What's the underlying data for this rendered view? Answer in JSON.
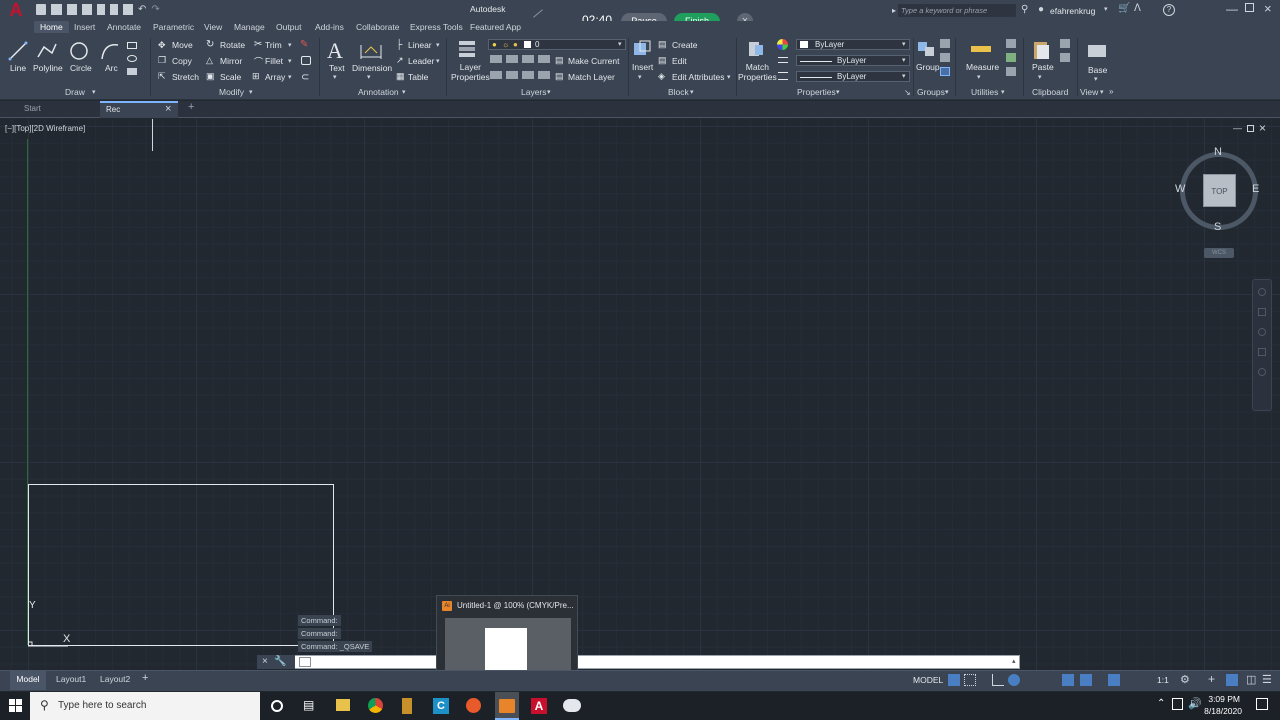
{
  "app": {
    "title": "Autodesk",
    "timer": "02:40",
    "pause_label": "Pause",
    "finish_label": "Finish",
    "search_placeholder": "Type a keyword or phrase",
    "user": "efahrenkrug"
  },
  "ribbon_tabs": [
    "Home",
    "Insert",
    "Annotate",
    "Parametric",
    "View",
    "Manage",
    "Output",
    "Add-ins",
    "Collaborate",
    "Express Tools",
    "Featured App"
  ],
  "draw": {
    "line": "Line",
    "polyline": "Polyline",
    "circle": "Circle",
    "arc": "Arc",
    "panel": "Draw"
  },
  "modify": {
    "move": "Move",
    "rotate": "Rotate",
    "trim": "Trim",
    "copy": "Copy",
    "mirror": "Mirror",
    "fillet": "Fillet",
    "stretch": "Stretch",
    "scale": "Scale",
    "array": "Array",
    "panel": "Modify"
  },
  "annotation": {
    "text": "Text",
    "dimension": "Dimension",
    "linear": "Linear",
    "leader": "Leader",
    "table": "Table",
    "panel": "Annotation"
  },
  "layers": {
    "layer_properties": "Layer\nProperties",
    "current_layer": "0",
    "make_current": "Make Current",
    "match_layer": "Match Layer",
    "panel": "Layers"
  },
  "block": {
    "insert": "Insert",
    "create": "Create",
    "edit": "Edit",
    "edit_attributes": "Edit Attributes",
    "panel": "Block"
  },
  "properties": {
    "match": "Match\nProperties",
    "color": "ByLayer",
    "linetype": "ByLayer",
    "lineweight": "ByLayer",
    "panel": "Properties"
  },
  "groups": {
    "group": "Group",
    "panel": "Groups"
  },
  "utilities": {
    "measure": "Measure",
    "panel": "Utilities"
  },
  "clipboard": {
    "paste": "Paste",
    "panel": "Clipboard"
  },
  "view": {
    "base": "Base",
    "panel": "View"
  },
  "doc_tabs": {
    "start": "Start",
    "rec": "Rec"
  },
  "viewport": {
    "label": "[−][Top][2D Wireframe]"
  },
  "viewcube": {
    "n": "N",
    "s": "S",
    "e": "E",
    "w": "W",
    "face": "TOP",
    "wcs": "WCS"
  },
  "command_history": [
    "Command:",
    "Command:",
    "Command:  _QSAVE"
  ],
  "preview": {
    "title": "Untitled-1 @ 100% (CMYK/Pre..."
  },
  "layout_tabs": [
    "Model",
    "Layout1",
    "Layout2"
  ],
  "status": {
    "model": "MODEL",
    "scale": "1:1"
  },
  "taskbar": {
    "search_placeholder": "Type here to search",
    "time": "3:09 PM",
    "date": "8/18/2020"
  },
  "colors": {
    "accent_red": "#c8102e",
    "finish_green": "#1f9e5e",
    "pause_gray": "#5e6673"
  }
}
